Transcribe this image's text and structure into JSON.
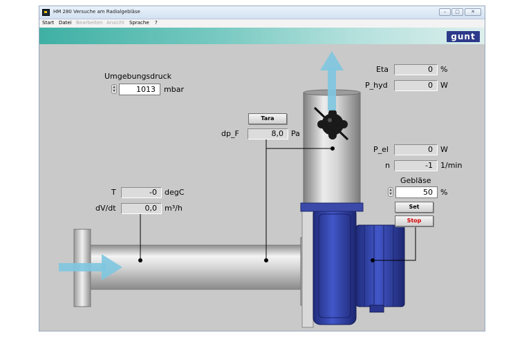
{
  "window": {
    "title": "HM 280 Versuche am Radialgebläse",
    "controls": {
      "minimize": "–",
      "maximize": "▢",
      "close": "✕"
    }
  },
  "menu": [
    {
      "label": "Start",
      "enabled": true
    },
    {
      "label": "Datei",
      "enabled": true
    },
    {
      "label": "Bearbeiten",
      "enabled": false
    },
    {
      "label": "Ansicht",
      "enabled": false
    },
    {
      "label": "Sprache",
      "enabled": true
    },
    {
      "label": "?",
      "enabled": true
    }
  ],
  "brand": {
    "logo_text": "gunt"
  },
  "panel": {
    "ambient_pressure": {
      "label": "Umgebungsdruck",
      "value": "1013",
      "unit": "mbar"
    },
    "eta": {
      "label": "Eta",
      "value": "0",
      "unit": "%"
    },
    "p_hyd": {
      "label": "P_hyd",
      "value": "0",
      "unit": "W"
    },
    "tara": {
      "label": "Tara"
    },
    "dp_f": {
      "label": "dp_F",
      "value": "8,0",
      "unit": "Pa"
    },
    "p_el": {
      "label": "P_el",
      "value": "0",
      "unit": "W"
    },
    "n": {
      "label": "n",
      "value": "-1",
      "unit": "1/min"
    },
    "blower": {
      "label": "Gebläse",
      "value": "50",
      "unit": "%",
      "set_label": "Set",
      "stop_label": "Stop"
    },
    "temperature": {
      "label": "T",
      "value": "-0",
      "unit": "degC"
    },
    "flow": {
      "label": "dV/dt",
      "value": "0,0",
      "unit": "m³/h"
    }
  },
  "colors": {
    "flow_arrow": "#7ec6e0",
    "blower_blue": "#2f3fa6",
    "pipe_gray": "#cfcfcf",
    "banner_teal": "#3fb0a4",
    "stop_red": "#d40000"
  }
}
